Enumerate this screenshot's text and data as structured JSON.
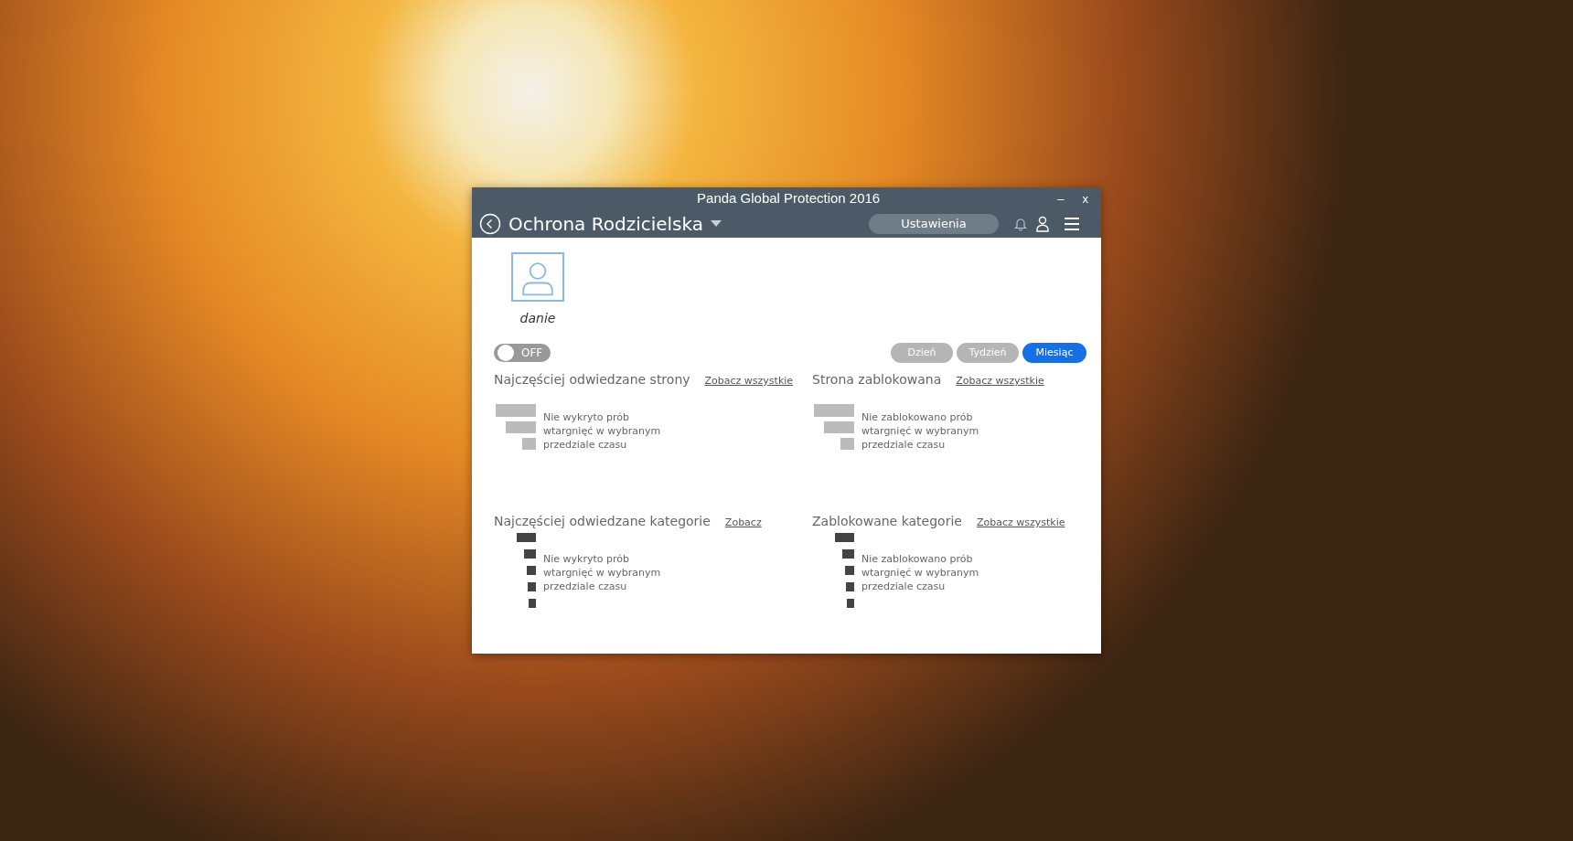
{
  "window": {
    "title": "Panda Global Protection 2016",
    "controls": [
      "–",
      "x"
    ]
  },
  "header": {
    "title": "Ochrona Rodzicielska",
    "settings_button": "Ustawienia"
  },
  "profile": {
    "name": "danie"
  },
  "toggle": {
    "on": false,
    "label": "OFF"
  },
  "periods": [
    {
      "label": "Dzień",
      "selected": false
    },
    {
      "label": "Tydzień",
      "selected": false
    },
    {
      "label": "Miesiąc",
      "selected": true
    }
  ],
  "panels": [
    {
      "title": "Najczęściej odwiedzane strony",
      "link": "Zobacz wszystkie",
      "message": "Nie wykryto prób wtargnięć w wybranym przedziale czasu",
      "kind": "sites"
    },
    {
      "title": "Strona zablokowana",
      "link": "Zobacz wszystkie",
      "message": "Nie zablokowano prób wtargnięć w wybranym przedziale czasu",
      "kind": "sites"
    },
    {
      "title": "Najczęściej odwiedzane kategorie",
      "link": "Zobacz",
      "message": "Nie wykryto prób wtargnięć w wybranym przedziale czasu",
      "kind": "categories"
    },
    {
      "title": "Zablokowane kategorie",
      "link": "Zobacz wszystkie",
      "message": "Nie zablokowano prób wtargnięć w wybranym przedziale czasu",
      "kind": "categories"
    }
  ]
}
